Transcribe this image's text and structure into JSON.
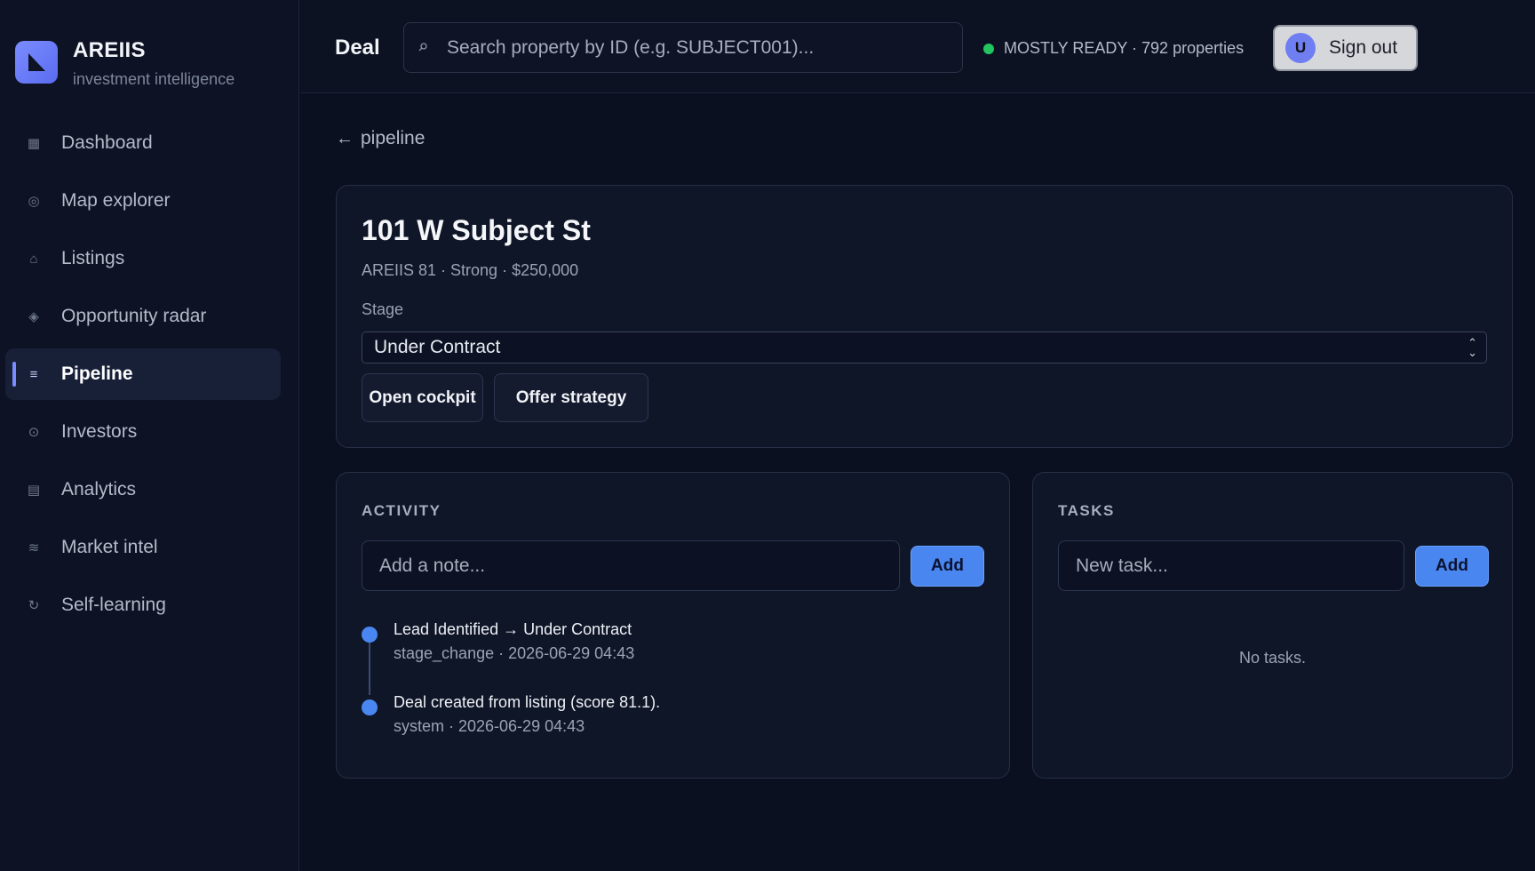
{
  "brand": {
    "name": "AREIIS",
    "tagline": "investment intelligence"
  },
  "nav": [
    {
      "label": "Dashboard",
      "icon": "grid-icon",
      "glyph": "▦",
      "active": false
    },
    {
      "label": "Map explorer",
      "icon": "globe-icon",
      "glyph": "◎",
      "active": false
    },
    {
      "label": "Listings",
      "icon": "home-icon",
      "glyph": "⌂",
      "active": false
    },
    {
      "label": "Opportunity radar",
      "icon": "diamond-icon",
      "glyph": "◈",
      "active": false
    },
    {
      "label": "Pipeline",
      "icon": "list-icon",
      "glyph": "≡",
      "active": true
    },
    {
      "label": "Investors",
      "icon": "target-icon",
      "glyph": "⊙",
      "active": false
    },
    {
      "label": "Analytics",
      "icon": "table-icon",
      "glyph": "▤",
      "active": false
    },
    {
      "label": "Market intel",
      "icon": "wave-icon",
      "glyph": "≋",
      "active": false
    },
    {
      "label": "Self-learning",
      "icon": "refresh-icon",
      "glyph": "↻",
      "active": false
    }
  ],
  "header": {
    "title": "Deal",
    "search_placeholder": "Search property by ID (e.g. SUBJECT001)...",
    "status_text": "MOSTLY READY · 792 properties",
    "status_color": "#22c55e",
    "avatar_letter": "U",
    "signout_label": "Sign out"
  },
  "back": {
    "label": "pipeline"
  },
  "deal": {
    "title": "101 W Subject St",
    "meta": "AREIIS 81 · Strong · $250,000",
    "stage_label": "Stage",
    "stage_value": "Under Contract",
    "open_cockpit": "Open cockpit",
    "offer_strategy": "Offer strategy"
  },
  "activity": {
    "title": "ACTIVITY",
    "note_placeholder": "Add a note...",
    "add_label": "Add",
    "events": [
      {
        "title": "Lead Identified → Under Contract",
        "meta": "stage_change · 2026-06-29 04:43"
      },
      {
        "title": "Deal created from listing (score 81.1).",
        "meta": "system · 2026-06-29 04:43"
      }
    ]
  },
  "tasks": {
    "title": "TASKS",
    "task_placeholder": "New task...",
    "add_label": "Add",
    "empty_text": "No tasks."
  },
  "colors": {
    "accent": "#7b8cff",
    "primary_button": "#4a86f0",
    "background": "#0b1020"
  }
}
